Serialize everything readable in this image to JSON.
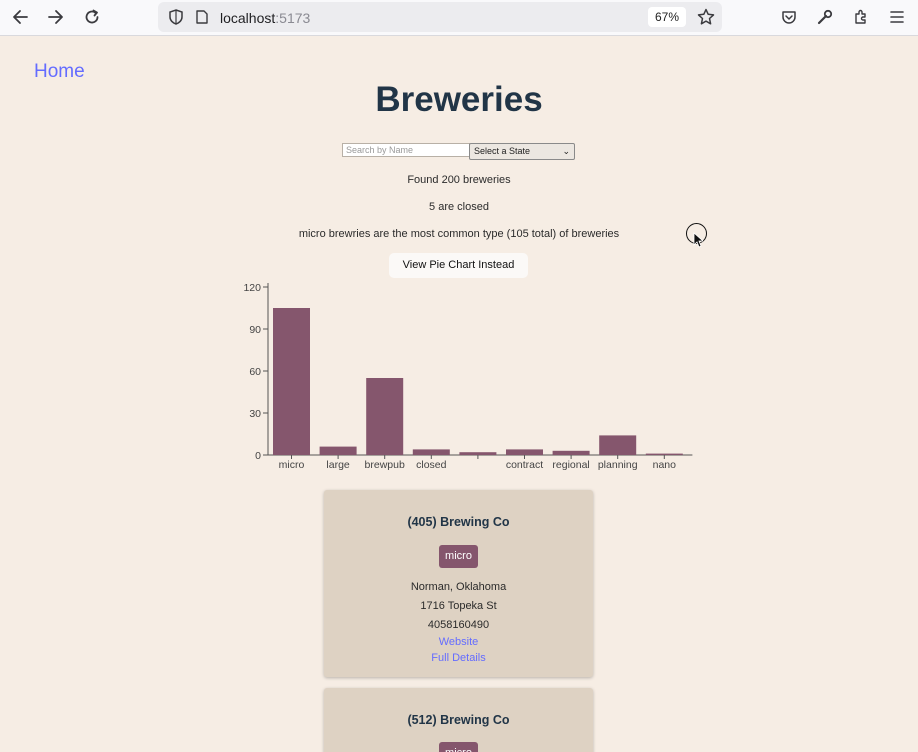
{
  "browser": {
    "url_host": "localhost",
    "url_port": ":5173",
    "zoom": "67%"
  },
  "page": {
    "home_link": "Home",
    "title": "Breweries",
    "search_placeholder": "Search by Name",
    "state_select": "Select a State",
    "stats": {
      "found": "Found 200 breweries",
      "closed": "5 are closed",
      "common": "micro brewries are the most common type (105 total) of breweries"
    },
    "pie_button": "View Pie Chart Instead"
  },
  "chart_data": {
    "type": "bar",
    "categories": [
      "micro",
      "large",
      "brewpub",
      "closed",
      "",
      "contract",
      "regional",
      "planning",
      "nano"
    ],
    "values": [
      105,
      6,
      55,
      4,
      2,
      4,
      3,
      14,
      1
    ],
    "yticks": [
      0,
      30,
      60,
      90,
      120
    ],
    "ylim": [
      0,
      120
    ],
    "bar_color": "#85566d"
  },
  "cards": [
    {
      "name": "(405) Brewing Co",
      "type": "micro",
      "location": "Norman, Oklahoma",
      "street": "1716 Topeka St",
      "phone": "4058160490",
      "website": "Website",
      "details": "Full Details"
    },
    {
      "name": "(512) Brewing Co",
      "type": "micro"
    }
  ],
  "colors": {
    "background": "#f6ede4",
    "card": "#ded2c3",
    "accent": "#85566d",
    "link": "#646cff"
  }
}
